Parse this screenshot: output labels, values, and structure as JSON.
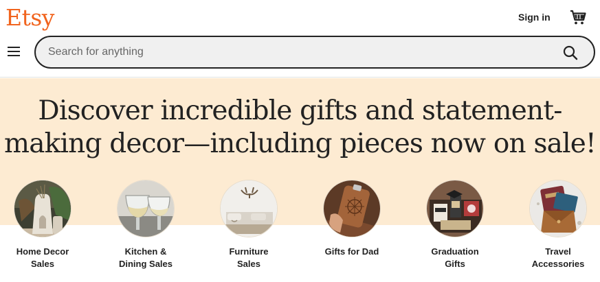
{
  "header": {
    "logo": "Etsy",
    "sign_in": "Sign in",
    "cart_icon": "cart-icon",
    "menu_icon": "hamburger-menu-icon"
  },
  "search": {
    "placeholder": "Search for anything",
    "value": "",
    "icon": "search-icon"
  },
  "hero": {
    "headline_line1": "Discover incredible gifts and statement-",
    "headline_line2": "making decor—including pieces now on sale!",
    "background_color": "#fdebd2"
  },
  "categories": [
    {
      "line1": "Home Decor",
      "line2": "Sales"
    },
    {
      "line1": "Kitchen &",
      "line2": "Dining Sales"
    },
    {
      "line1": "Furniture",
      "line2": "Sales"
    },
    {
      "line1": "Gifts for Dad",
      "line2": ""
    },
    {
      "line1": "Graduation",
      "line2": "Gifts"
    },
    {
      "line1": "Travel",
      "line2": "Accessories"
    }
  ],
  "colors": {
    "brand": "#f1641e",
    "text": "#222222"
  }
}
